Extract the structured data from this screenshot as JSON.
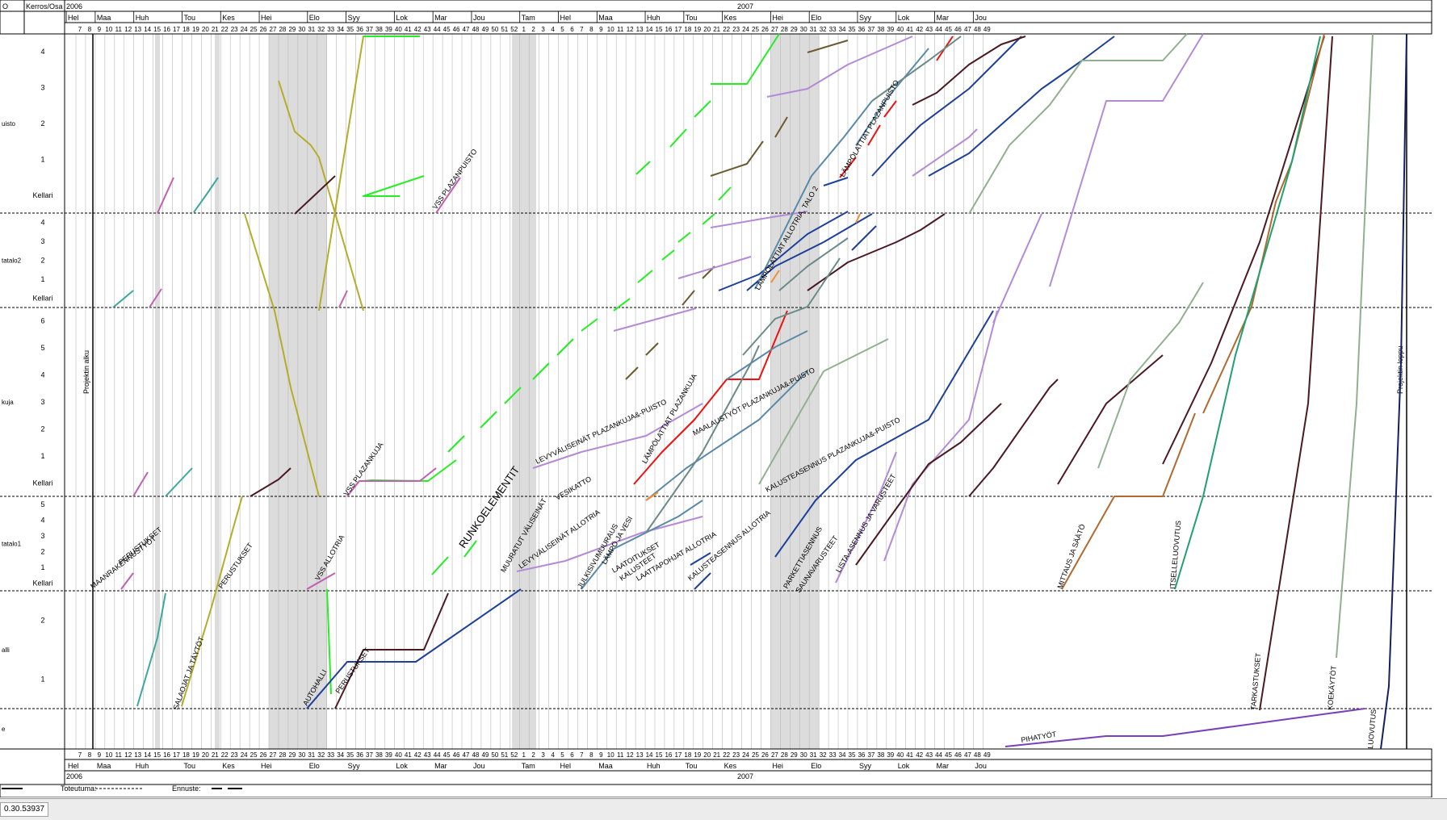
{
  "header": {
    "corner_label": "O",
    "floor_column_label": "Kerros/Osa",
    "year_start": "2006",
    "year_mid": "2007"
  },
  "months": [
    {
      "label": "Hel",
      "week": 6
    },
    {
      "label": "Maa",
      "week": 9
    },
    {
      "label": "Huh",
      "week": 13
    },
    {
      "label": "Tou",
      "week": 18
    },
    {
      "label": "Kes",
      "week": 22
    },
    {
      "label": "Hei",
      "week": 26
    },
    {
      "label": "Elo",
      "week": 31
    },
    {
      "label": "Syy",
      "week": 35
    },
    {
      "label": "Lok",
      "week": 40
    },
    {
      "label": "Mar",
      "week": 44
    },
    {
      "label": "Jou",
      "week": 48
    },
    {
      "label": "Tam",
      "week": 53
    },
    {
      "label": "Hel",
      "week": 57
    },
    {
      "label": "Maa",
      "week": 61
    },
    {
      "label": "Huh",
      "week": 66
    },
    {
      "label": "Tou",
      "week": 70
    },
    {
      "label": "Kes",
      "week": 74
    },
    {
      "label": "Hei",
      "week": 79
    },
    {
      "label": "Elo",
      "week": 83
    },
    {
      "label": "Syy",
      "week": 88
    },
    {
      "label": "Lok",
      "week": 92
    },
    {
      "label": "Mar",
      "week": 96
    },
    {
      "label": "Jou",
      "week": 100
    }
  ],
  "week_numbers": [
    "7",
    "8",
    "9",
    "10",
    "11",
    "12",
    "13",
    "14",
    "15",
    "16",
    "17",
    "18",
    "19",
    "20",
    "21",
    "22",
    "23",
    "24",
    "25",
    "26",
    "27",
    "28",
    "29",
    "30",
    "31",
    "32",
    "33",
    "34",
    "35",
    "36",
    "37",
    "38",
    "39",
    "40",
    "41",
    "42",
    "43",
    "44",
    "45",
    "46",
    "47",
    "48",
    "49",
    "50",
    "51",
    "52",
    "1",
    "2",
    "3",
    "4",
    "5",
    "6",
    "7",
    "8",
    "9",
    "10",
    "11",
    "12",
    "13",
    "14",
    "15",
    "16",
    "17",
    "18",
    "19",
    "20",
    "21",
    "22",
    "23",
    "24",
    "25",
    "26",
    "27",
    "28",
    "29",
    "30",
    "31",
    "32",
    "33",
    "34",
    "35",
    "36",
    "37",
    "38",
    "39",
    "40",
    "41",
    "42",
    "43",
    "44",
    "45",
    "46",
    "47",
    "48",
    "49"
  ],
  "sections": [
    {
      "name": "uisto",
      "floors": [
        "4",
        "3",
        "2",
        "1",
        "Kellari"
      ]
    },
    {
      "name": "tatalo2",
      "floors": [
        "4",
        "3",
        "2",
        "1",
        "Kellari"
      ]
    },
    {
      "name": "kuja",
      "floors": [
        "6",
        "5",
        "4",
        "3",
        "2",
        "1",
        "Kellari"
      ]
    },
    {
      "name": "tatalo1",
      "floors": [
        "5",
        "4",
        "3",
        "2",
        "1",
        "Kellari"
      ]
    },
    {
      "name": "alli",
      "floors": [
        "2",
        "1"
      ]
    },
    {
      "name": "e",
      "floors": [
        ""
      ]
    }
  ],
  "milestones": {
    "start": "Projektin alku",
    "end": "Projektin loppu"
  },
  "task_labels": [
    "MAANRAKENNUSTYÖT",
    "PERUSTUKSET",
    "SALAOJAT JA TÄYTÖT",
    "PERUSTUKSET",
    "VSS ALLOTRIA",
    "AUTOHALLI",
    "PERUSTUKSET",
    "VSS PLAZANKUJA",
    "VSS PLAZANPUISTO",
    "RUNKOELEMENTIT",
    "MUURATUT VÄLISEINÄT",
    "LEVYVÄLISEINÄT ALLOTRIA",
    "VESIKATTO",
    "LEVYVÄLISEINÄT PLAZANKUJA&-PUISTO",
    "JULKISIVUMUURAUS",
    "LÄMPÖ JA VESI",
    "KALUSTEET",
    "LAATOITUKSET",
    "LAATTAPOHJAT ALLOTRIA",
    "LÄMPÖLATTIAT PLAZANKUJA",
    "MAALAUSTYÖT PLAZANKUJA&-PUISTO",
    "KALUSTEASENNUS ALLOTRIA",
    "KALUSTEASENNUS PLAZANKUJA&-PUISTO",
    "LÄMPÖLATTIAT ALLOTRIA, TALO 2",
    "LÄMPÖLATTIAT PLAZANPUISTO",
    "PARKETTIASENNUS",
    "SAUNAVARUSTEET",
    "LISTA-ASENNUS JA VARUSTEET",
    "MITTAUS JA SÄÄTÖ",
    "ITSELLELUOVUTUS",
    "TARKASTUKSET",
    "KOEKÄYTÖT",
    "LUOVUTUS",
    "PIHATYÖT"
  ],
  "legend": {
    "actual": "Toteutuma:",
    "forecast": "Ennuste:"
  },
  "status_text": "0.30.53937",
  "colors": {
    "grid": "#9a9a9a",
    "holiday": "#dcdcdc",
    "green": "#22ee22",
    "olive": "#b5ad2a",
    "brown_olive": "#6b5a2e",
    "lavender": "#b48ad6",
    "navy": "#1e3f9a",
    "dark_navy": "#152060",
    "maroon": "#4a1a22",
    "red": "#ee1111",
    "teal": "#3aa8a0",
    "magenta": "#c060b0",
    "steel": "#5a8aa8",
    "slate": "#6a8a8a",
    "copper": "#b06a30",
    "sea_green": "#20a070",
    "sage": "#90b090",
    "purple": "#7a40b8",
    "orange": "#f09030"
  }
}
